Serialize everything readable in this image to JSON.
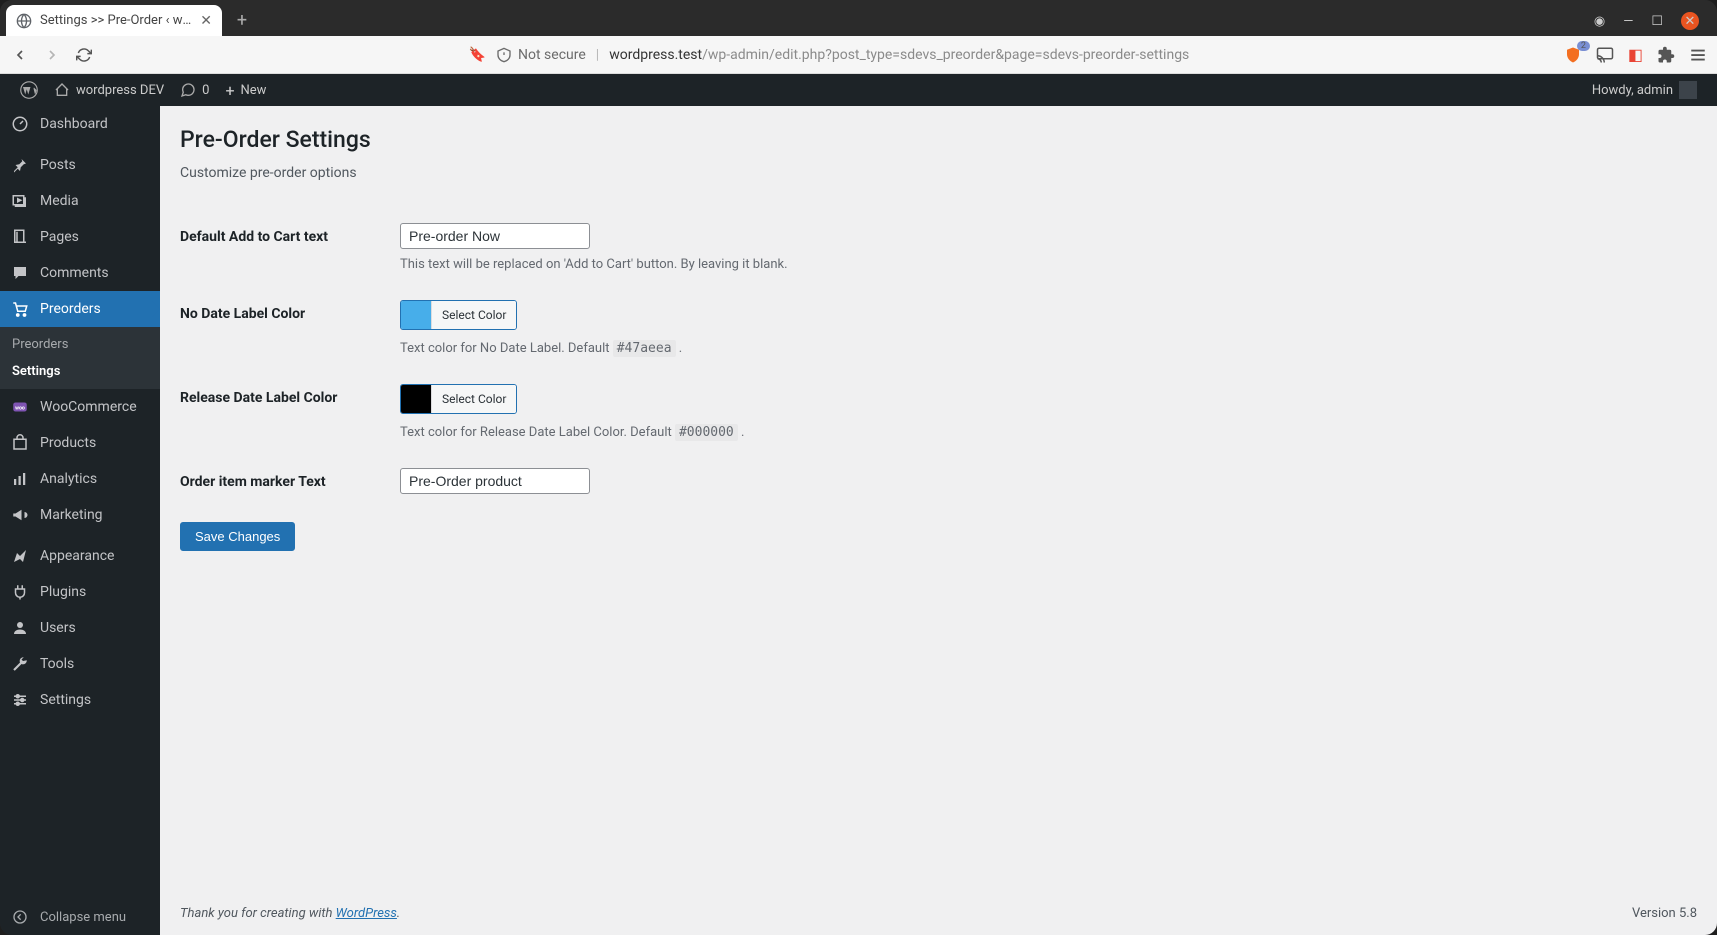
{
  "browser": {
    "tab_title": "Settings >> Pre-Order ‹ wo…",
    "not_secure_label": "Not secure",
    "url_host": "wordpress.test",
    "url_path": "/wp-admin/edit.php?post_type=sdevs_preorder&page=sdevs-preorder-settings",
    "shield_badge": "2"
  },
  "adminbar": {
    "site_name": "wordpress DEV",
    "comments_count": "0",
    "new_label": "New",
    "howdy": "Howdy, admin"
  },
  "sidebar": {
    "items": [
      {
        "label": "Dashboard"
      },
      {
        "label": "Posts"
      },
      {
        "label": "Media"
      },
      {
        "label": "Pages"
      },
      {
        "label": "Comments"
      },
      {
        "label": "Preorders"
      },
      {
        "label": "WooCommerce"
      },
      {
        "label": "Products"
      },
      {
        "label": "Analytics"
      },
      {
        "label": "Marketing"
      },
      {
        "label": "Appearance"
      },
      {
        "label": "Plugins"
      },
      {
        "label": "Users"
      },
      {
        "label": "Tools"
      },
      {
        "label": "Settings"
      }
    ],
    "submenu": {
      "preorders": "Preorders",
      "settings": "Settings"
    },
    "collapse": "Collapse menu"
  },
  "page": {
    "title": "Pre-Order Settings",
    "subtitle": "Customize pre-order options",
    "fields": {
      "cart_text": {
        "label": "Default Add to Cart text",
        "value": "Pre-order Now",
        "desc": "This text will be replaced on 'Add to Cart' button. By leaving it blank."
      },
      "no_date_color": {
        "label": "No Date Label Color",
        "btn": "Select Color",
        "swatch": "#47aeea",
        "desc_pre": "Text color for No Date Label. Default ",
        "default": "#47aeea",
        "desc_post": " ."
      },
      "release_color": {
        "label": "Release Date Label Color",
        "btn": "Select Color",
        "swatch": "#000000",
        "desc_pre": "Text color for Release Date Label Color. Default ",
        "default": "#000000",
        "desc_post": " ."
      },
      "marker_text": {
        "label": "Order item marker Text",
        "value": "Pre-Order product"
      }
    },
    "submit": "Save Changes"
  },
  "footer": {
    "prefix": "Thank you for creating with ",
    "link": "WordPress",
    "suffix": ".",
    "version": "Version 5.8"
  }
}
